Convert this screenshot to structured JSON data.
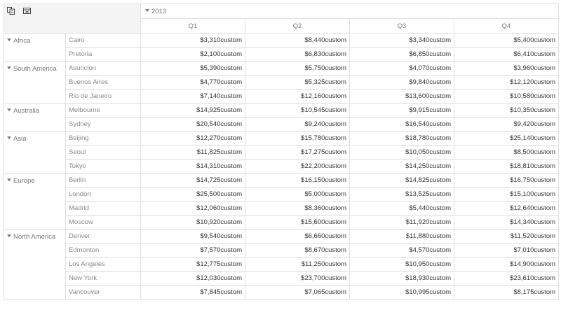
{
  "toolbar": {
    "icons": [
      "field-chooser-icon",
      "export-excel-icon"
    ]
  },
  "header": {
    "year": "2013",
    "quarters": [
      "Q1",
      "Q2",
      "Q3",
      "Q4"
    ]
  },
  "groups": [
    {
      "country": "Africa",
      "rows": [
        {
          "city": "Cairo",
          "values": [
            "$3,310custom",
            "$8,440custom",
            "$3,340custom",
            "$5,400custom"
          ]
        },
        {
          "city": "Pretoria",
          "values": [
            "$2,100custom",
            "$6,830custom",
            "$6,850custom",
            "$6,410custom"
          ]
        }
      ]
    },
    {
      "country": "South America",
      "rows": [
        {
          "city": "Asuncion",
          "values": [
            "$5,390custom",
            "$5,750custom",
            "$4,070custom",
            "$3,960custom"
          ]
        },
        {
          "city": "Buenos Aires",
          "values": [
            "$4,770custom",
            "$5,325custom",
            "$9,840custom",
            "$12,120custom"
          ]
        },
        {
          "city": "Rio de Janeiro",
          "values": [
            "$7,140custom",
            "$12,160custom",
            "$13,600custom",
            "$10,580custom"
          ]
        }
      ]
    },
    {
      "country": "Australia",
      "rows": [
        {
          "city": "Melbourne",
          "values": [
            "$14,925custom",
            "$10,545custom",
            "$9,915custom",
            "$10,350custom"
          ]
        },
        {
          "city": "Sydney",
          "values": [
            "$20,540custom",
            "$9,240custom",
            "$16,540custom",
            "$9,420custom"
          ]
        }
      ]
    },
    {
      "country": "Asia",
      "rows": [
        {
          "city": "Beijing",
          "values": [
            "$12,270custom",
            "$15,780custom",
            "$18,780custom",
            "$25,140custom"
          ]
        },
        {
          "city": "Seoul",
          "values": [
            "$11,825custom",
            "$17,275custom",
            "$10,050custom",
            "$8,500custom"
          ]
        },
        {
          "city": "Tokyo",
          "values": [
            "$14,310custom",
            "$22,200custom",
            "$14,250custom",
            "$18,810custom"
          ]
        }
      ]
    },
    {
      "country": "Europe",
      "rows": [
        {
          "city": "Berlin",
          "values": [
            "$14,725custom",
            "$16,150custom",
            "$14,825custom",
            "$16,750custom"
          ]
        },
        {
          "city": "London",
          "values": [
            "$25,500custom",
            "$5,000custom",
            "$13,525custom",
            "$15,100custom"
          ]
        },
        {
          "city": "Madrid",
          "values": [
            "$12,060custom",
            "$8,360custom",
            "$5,440custom",
            "$12,640custom"
          ]
        },
        {
          "city": "Moscow",
          "values": [
            "$10,920custom",
            "$15,600custom",
            "$11,920custom",
            "$14,340custom"
          ]
        }
      ]
    },
    {
      "country": "North America",
      "rows": [
        {
          "city": "Denver",
          "values": [
            "$9,540custom",
            "$6,660custom",
            "$11,880custom",
            "$11,520custom"
          ]
        },
        {
          "city": "Edmonton",
          "values": [
            "$7,570custom",
            "$8,670custom",
            "$4,570custom",
            "$7,010custom"
          ]
        },
        {
          "city": "Los Angeles",
          "values": [
            "$12,775custom",
            "$11,250custom",
            "$10,950custom",
            "$14,900custom"
          ]
        },
        {
          "city": "New York",
          "values": [
            "$12,030custom",
            "$23,700custom",
            "$18,930custom",
            "$23,610custom"
          ]
        },
        {
          "city": "Vancouver",
          "values": [
            "$7,845custom",
            "$7,065custom",
            "$10,995custom",
            "$8,175custom"
          ]
        }
      ]
    }
  ],
  "colors": {
    "border": "#e0e0e0",
    "header_bg": "#f4f4f4",
    "muted_text": "#777777",
    "value_text": "#333333"
  }
}
